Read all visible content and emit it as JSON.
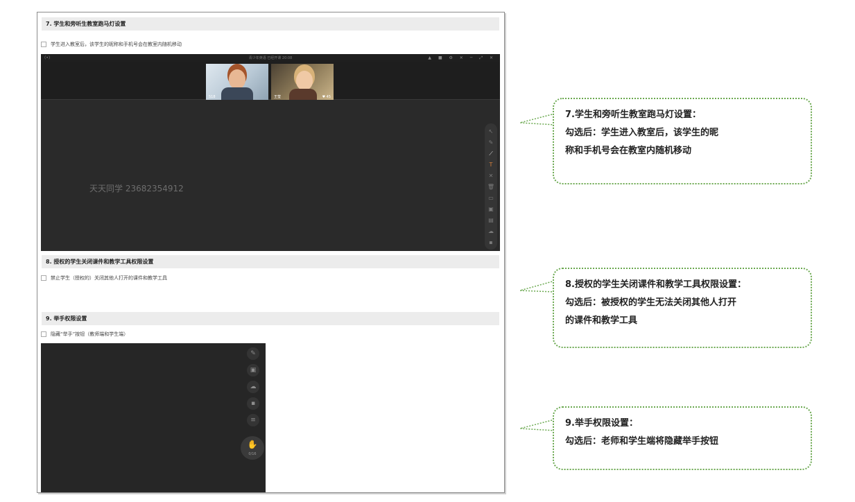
{
  "section7": {
    "heading": "7. 学生和旁听生教室跑马灯设置",
    "option": "学生进入教室后，该学生的昵称和手机号会在教室内随机移动",
    "classroom": {
      "signal": "(•)",
      "title": "青少年英语    已经开课 20:08",
      "controls": "▲ ■ ⚙ ✕ ─ ⤢ ✕",
      "teacher_label": "518",
      "student_label": "王莹",
      "student_badge": "♥ 45",
      "marquee_text": "天天同学 23682354912",
      "toolbar_icons": [
        "↖",
        "✎",
        "⟋",
        "T",
        "✕",
        "🗑",
        "▭",
        "▣",
        "▤",
        "☁",
        "▪"
      ]
    }
  },
  "section8": {
    "heading": "8. 授权的学生关闭课件和教学工具权限设置",
    "option": "禁止学生（授权的）关闭其他人打开的课件和教学工具"
  },
  "section9": {
    "heading": "9. 举手权限设置",
    "option": "隐藏“举手”按钮（教师端和学生端）",
    "hand_tools": [
      "✎",
      "▣",
      "☁",
      "▪",
      "≡"
    ],
    "hand_icon": "✋",
    "hand_count": "0/16"
  },
  "callouts": [
    {
      "line1": "7.学生和旁听生教室跑马灯设置：",
      "line2": "勾选后：学生进入教室后，该学生的昵",
      "line3": "称和手机号会在教室内随机移动"
    },
    {
      "line1": "8.授权的学生关闭课件和教学工具权限设置：",
      "line2": "勾选后：被授权的学生无法关闭其他人打开",
      "line3": "的课件和教学工具"
    },
    {
      "line1": "9.举手权限设置：",
      "line2": "勾选后：老师和学生端将隐藏举手按钮"
    }
  ]
}
